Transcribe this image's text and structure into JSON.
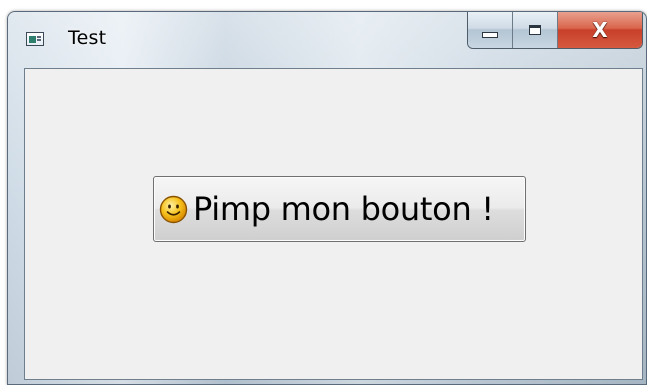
{
  "window": {
    "title": "Test",
    "app_icon": "window-app-icon",
    "caption_buttons": {
      "minimize_icon": "minimize-icon",
      "maximize_icon": "maximize-icon",
      "close_label": "X"
    }
  },
  "client": {
    "button": {
      "label": "Pimp mon bouton !",
      "icon": "smiley-icon"
    }
  },
  "colors": {
    "client_background": "#f0f0f0",
    "close_button": "#c8402a"
  }
}
